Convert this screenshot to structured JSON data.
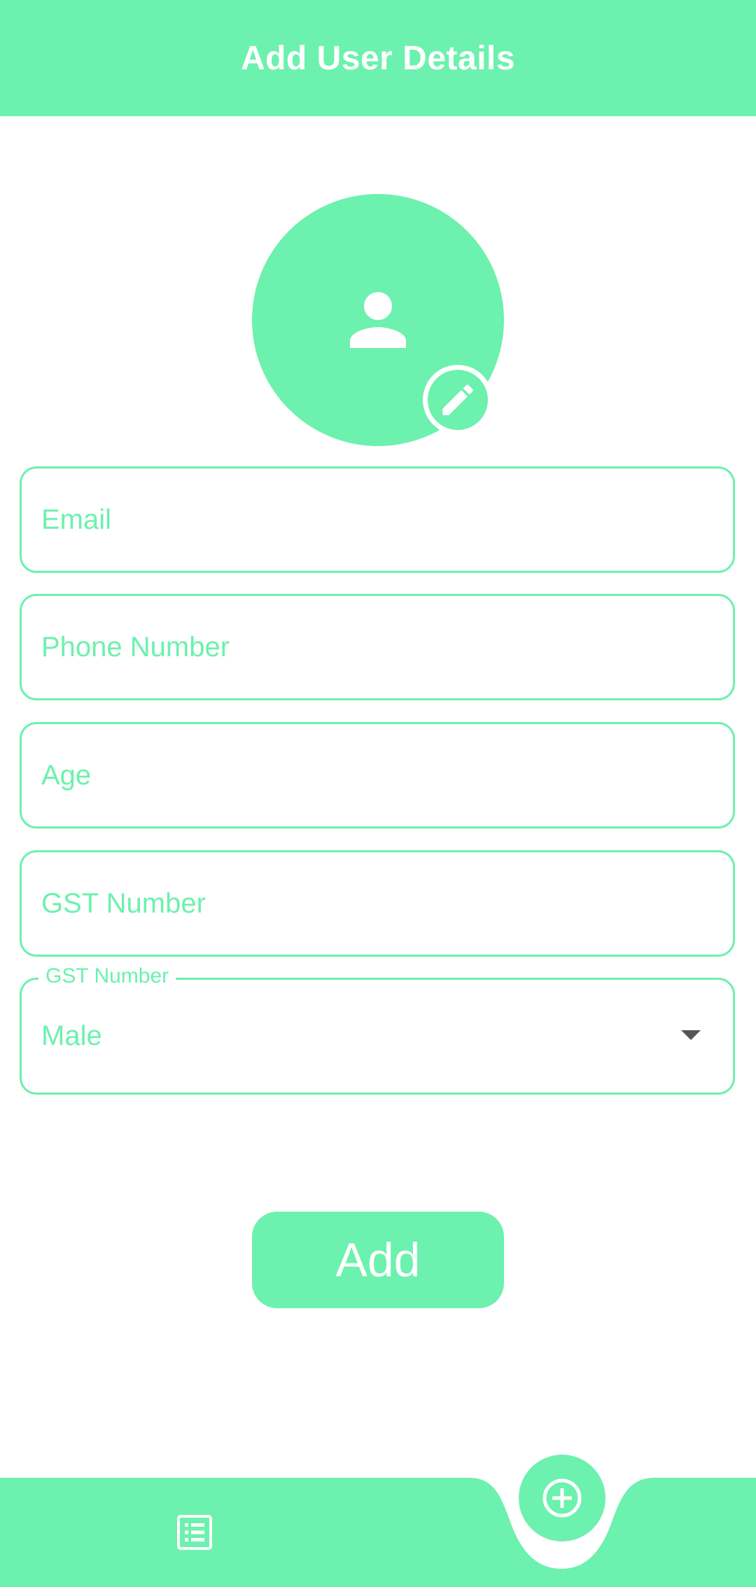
{
  "header": {
    "title": "Add User Details"
  },
  "avatar": {
    "icon": "person-icon",
    "edit_icon": "pencil-icon"
  },
  "form": {
    "email_placeholder": "Email",
    "phone_placeholder": "Phone Number",
    "age_placeholder": "Age",
    "gst_placeholder": "GST Number",
    "dropdown_label": "GST Number",
    "dropdown_value": "Male"
  },
  "actions": {
    "add_label": "Add"
  },
  "bottom_nav": {
    "left_icon": "list-icon",
    "center_icon": "add-circle-icon"
  },
  "colors": {
    "accent": "#6df1ae",
    "background": "#ffffff",
    "caret": "#555555"
  }
}
